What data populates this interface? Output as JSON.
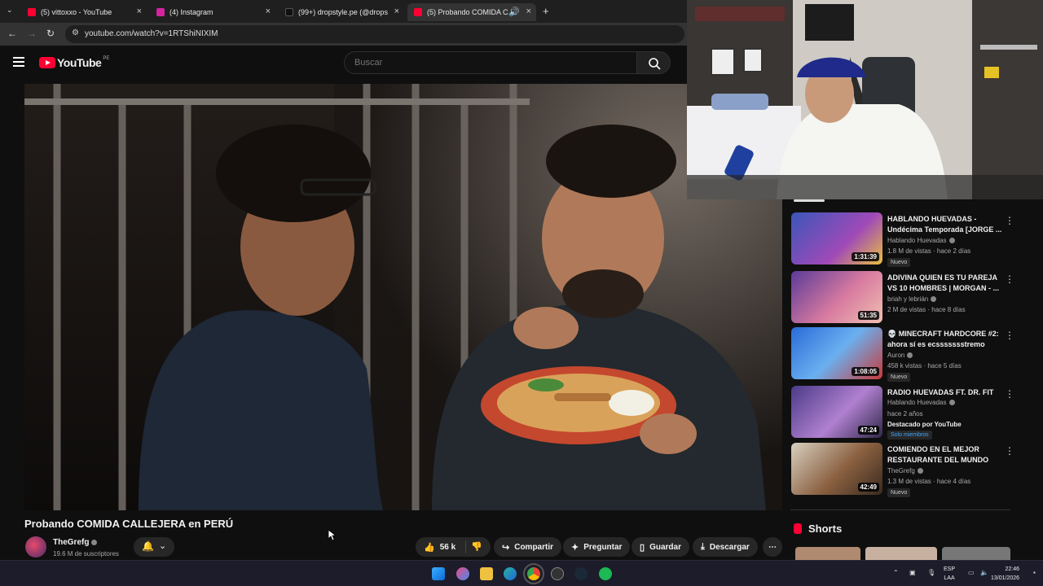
{
  "browser": {
    "tabs": [
      {
        "label": "(5) vittoxxo - YouTube",
        "favicon_color": "#ff0033"
      },
      {
        "label": "(4) Instagram",
        "favicon_color": "#d6249f"
      },
      {
        "label": "(99+) dropstyle.pe (@dropstyle",
        "favicon_color": "#111111"
      },
      {
        "label": "(5) Probando COMIDA CAL",
        "favicon_color": "#ff0033"
      }
    ],
    "new_tab": "+",
    "url": "youtube.com/watch?v=1RTShiNIXIM"
  },
  "youtube": {
    "logo_word": "YouTube",
    "country_code": "PE",
    "search_placeholder": "Buscar"
  },
  "video": {
    "title": "Probando COMIDA CALLEJERA en PERÚ",
    "channel": "TheGrefg",
    "subscribers": "19.6 M de suscriptores",
    "likes": "56 k",
    "share_label": "Compartir",
    "ask_label": "Preguntar",
    "save_label": "Guardar",
    "download_label": "Descargar"
  },
  "recommendations": [
    {
      "title": "HABLANDO HUEVADAS - Undécima Temporada [JORGE ...",
      "channel": "Hablando Huevadas",
      "meta": "1.8 M de vistas · hace 2 días",
      "duration": "1:31:39",
      "badge": "Nuevo",
      "thumb_color": "#4a68c8"
    },
    {
      "title": "ADIVINA QUIEN ES TU PAREJA VS 10 HOMBRES | MORGAN - ...",
      "channel": "briah y lebrián",
      "meta": "2 M de vistas · hace 8 días",
      "duration": "51:35",
      "badge": "",
      "thumb_color": "#7a4aa8"
    },
    {
      "title": "💀 MINECRAFT HARDCORE #2: ahora sí es ecssssssstremo",
      "channel": "Auron",
      "meta": "458 k vistas · hace 5 días",
      "duration": "1:08:05",
      "badge": "Nuevo",
      "thumb_color": "#3a7ad8"
    },
    {
      "title": "RADIO HUEVADAS FT. DR. FIT",
      "channel": "Hablando Huevadas",
      "meta": "hace 2 años",
      "duration": "47:24",
      "badge": "",
      "featured": "Destacado por YouTube",
      "members": "Solo miembros",
      "thumb_color": "#6a4a9a"
    },
    {
      "title": "COMIENDO EN EL MEJOR RESTAURANTE DEL MUNDO",
      "channel": "TheGrefg",
      "meta": "1.3 M de vistas · hace 4 días",
      "duration": "42:49",
      "badge": "Nuevo",
      "thumb_color": "#8a6a4a"
    }
  ],
  "shorts": {
    "title": "Shorts"
  },
  "taskbar": {
    "lang_line1": "ESP",
    "lang_line2": "LAA",
    "time": "22:46",
    "date": "13/01/2026"
  }
}
